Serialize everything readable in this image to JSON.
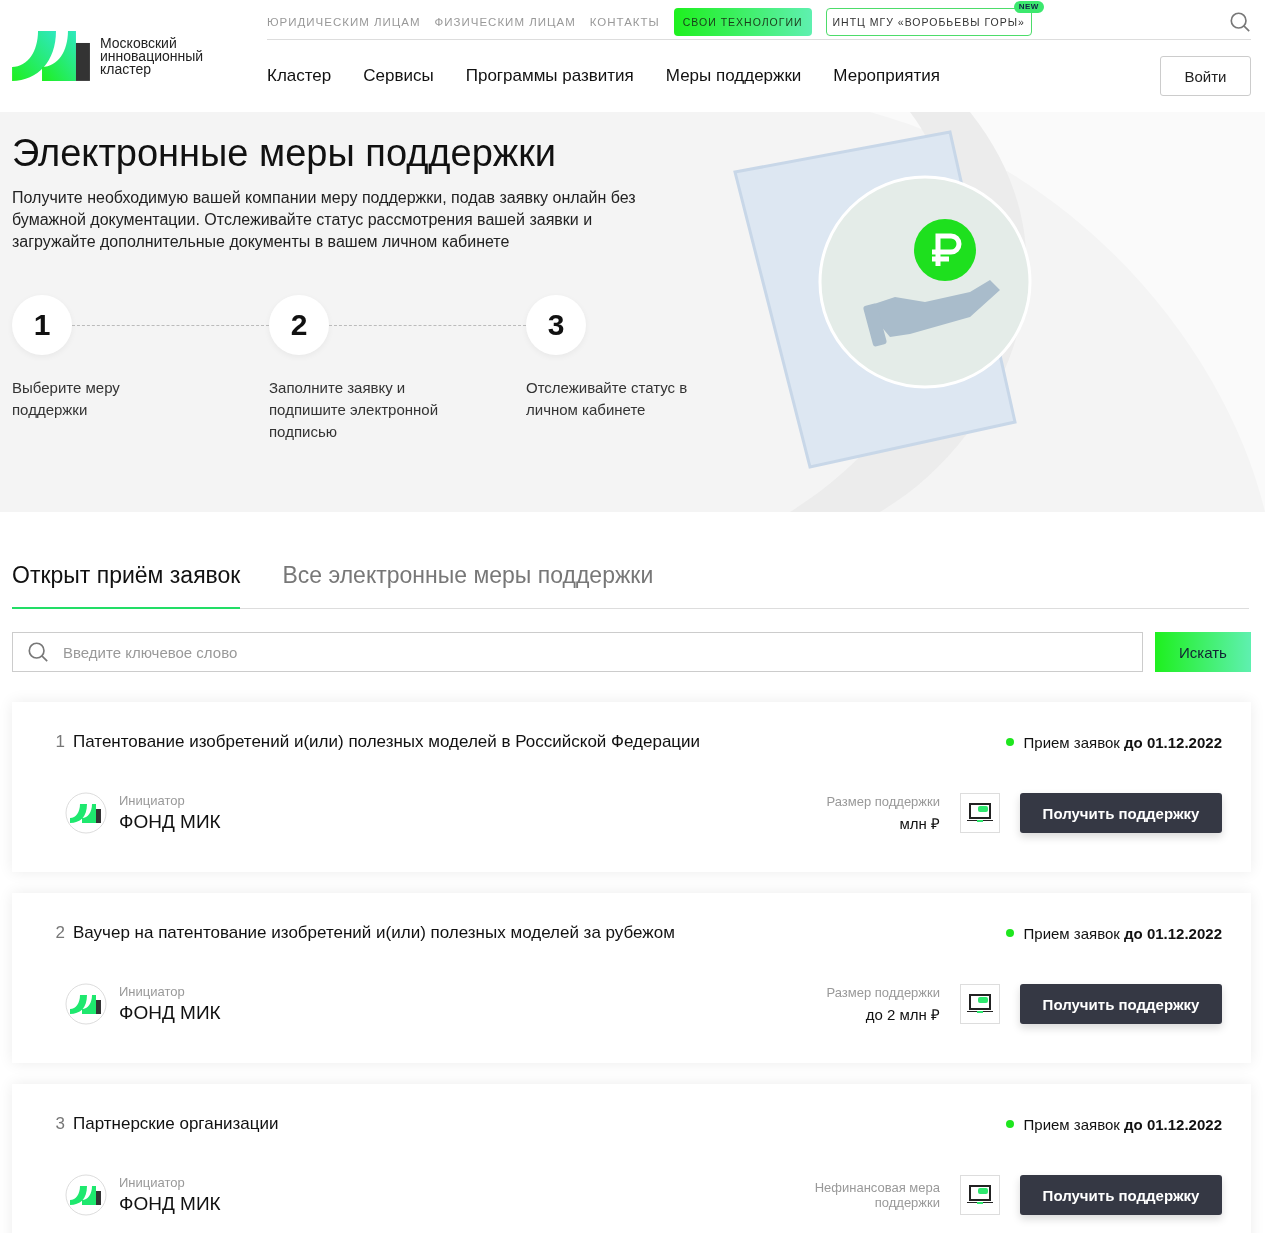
{
  "header": {
    "logo_text": "Московский инновационный кластер",
    "top_links": [
      {
        "label": "ЮРИДИЧЕСКИМ ЛИЦАМ",
        "kind": "link"
      },
      {
        "label": "ФИЗИЧЕСКИМ ЛИЦАМ",
        "kind": "link"
      },
      {
        "label": "КОНТАКТЫ",
        "kind": "link"
      },
      {
        "label": "СВОИ ТЕХНОЛОГИИ",
        "kind": "filled"
      },
      {
        "label": "ИНТЦ МГУ «ВОРОБЬЕВЫ ГОРЫ»",
        "kind": "outlined",
        "badge": "NEW"
      }
    ],
    "nav": [
      "Кластер",
      "Сервисы",
      "Программы развития",
      "Меры поддержки",
      "Мероприятия"
    ],
    "login": "Войти"
  },
  "hero": {
    "title": "Электронные меры поддержки",
    "text": "Получите необходимую вашей компании меру поддержки, подав заявку онлайн без бумажной документации. Отслеживайте статус рассмотрения вашей заявки и загружайте дополнительные документы в вашем личном кабинете",
    "steps": [
      {
        "number": "1",
        "label": "Выберите меру поддержки"
      },
      {
        "number": "2",
        "label": "Заполните заявку и подпишите электронной подписью"
      },
      {
        "number": "3",
        "label": "Отслеживайте статус в личном кабинете"
      }
    ]
  },
  "tabs": [
    {
      "label": "Открыт приём заявок",
      "selected": true
    },
    {
      "label": "Все электронные меры поддержки",
      "selected": false
    }
  ],
  "search": {
    "placeholder": "Введите ключевое слово",
    "button": "Искать"
  },
  "measures": [
    {
      "number": "1",
      "title": "Патентование изобретений и(или) полезных моделей в Российской Федерации",
      "status": "Прием заявок **до 01.12.2022**",
      "color": "#1ee61e",
      "initiator_label": "Инициатор",
      "initiator": "ФОНД МИК",
      "size_label": "Размер поддержки",
      "size_value": "млн ₽",
      "button": "Получить поддержку"
    },
    {
      "number": "2",
      "title": "Ваучер на патентование изобретений и(или) полезных моделей за рубежом",
      "status": "Прием заявок **до 01.12.2022**",
      "color": "#1ee61e",
      "initiator_label": "Инициатор",
      "initiator": "ФОНД МИК",
      "size_label": "Размер поддержки",
      "size_value": "до 2 млн ₽",
      "button": "Получить поддержку"
    },
    {
      "number": "3",
      "title": "Партнерские организации",
      "status": "Прием заявок **до 01.12.2022**",
      "color": "#1ee61e",
      "initiator_label": "Инициатор",
      "initiator": "ФОНД МИК",
      "size_label": "Нефинансовая мера поддержки",
      "button": "Получить поддержку"
    }
  ]
}
